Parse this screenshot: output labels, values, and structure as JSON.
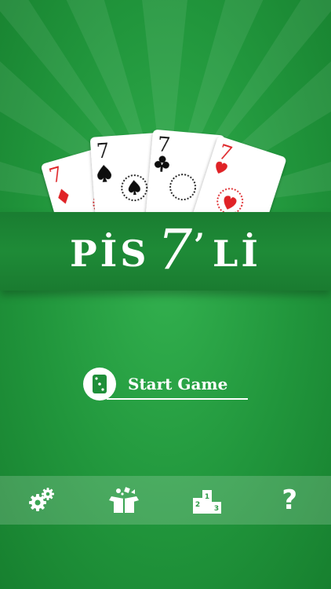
{
  "logo": {
    "part1": "PİS",
    "seven": "7",
    "apostrophe": "’",
    "part2": "Lİ"
  },
  "cards": [
    {
      "rank": "7",
      "suit": "diamond",
      "color": "#e02426"
    },
    {
      "rank": "7",
      "suit": "spade",
      "color": "#111111"
    },
    {
      "rank": "7",
      "suit": "club",
      "color": "#111111"
    },
    {
      "rank": "7",
      "suit": "heart",
      "color": "#e02426"
    }
  ],
  "start_button": {
    "label": "Start Game",
    "icon": "card-icon"
  },
  "toolbar": {
    "settings_icon": "gears-icon",
    "store_icon": "gift-box-icon",
    "podium_icon": "podium-icon",
    "podium_labels": [
      "1",
      "2",
      "3"
    ],
    "help_label": "?"
  },
  "colors": {
    "background": "#21963c",
    "banner": "#1e8b37",
    "red_suit": "#e02426",
    "black_suit": "#111111"
  }
}
